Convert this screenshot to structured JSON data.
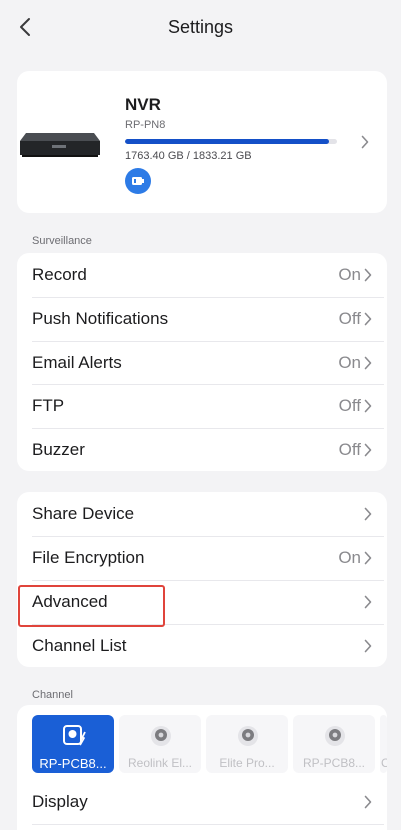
{
  "header": {
    "title": "Settings"
  },
  "device": {
    "name": "NVR",
    "model": "RP-PN8",
    "storage_text": "1763.40 GB / 1833.21 GB",
    "storage_used_fraction": 0.962
  },
  "surveillance": {
    "label": "Surveillance",
    "items": [
      {
        "label": "Record",
        "value": "On"
      },
      {
        "label": "Push Notifications",
        "value": "Off"
      },
      {
        "label": "Email Alerts",
        "value": "On"
      },
      {
        "label": "FTP",
        "value": "Off"
      },
      {
        "label": "Buzzer",
        "value": "Off"
      }
    ]
  },
  "general": {
    "items": [
      {
        "label": "Share Device",
        "value": ""
      },
      {
        "label": "File Encryption",
        "value": "On"
      },
      {
        "label": "Advanced",
        "value": ""
      },
      {
        "label": "Channel List",
        "value": ""
      }
    ]
  },
  "channel": {
    "label": "Channel",
    "tiles": [
      {
        "name": "RP-PCB8...",
        "active": true
      },
      {
        "name": "Reolink El...",
        "active": false
      },
      {
        "name": "Elite Pro...",
        "active": false
      },
      {
        "name": "RP-PCB8...",
        "active": false
      },
      {
        "name": "C",
        "active": false
      }
    ],
    "display_label": "Display"
  },
  "colors": {
    "accent": "#1a5fd6",
    "highlight": "#e0443b",
    "background": "#f3f3f5"
  }
}
